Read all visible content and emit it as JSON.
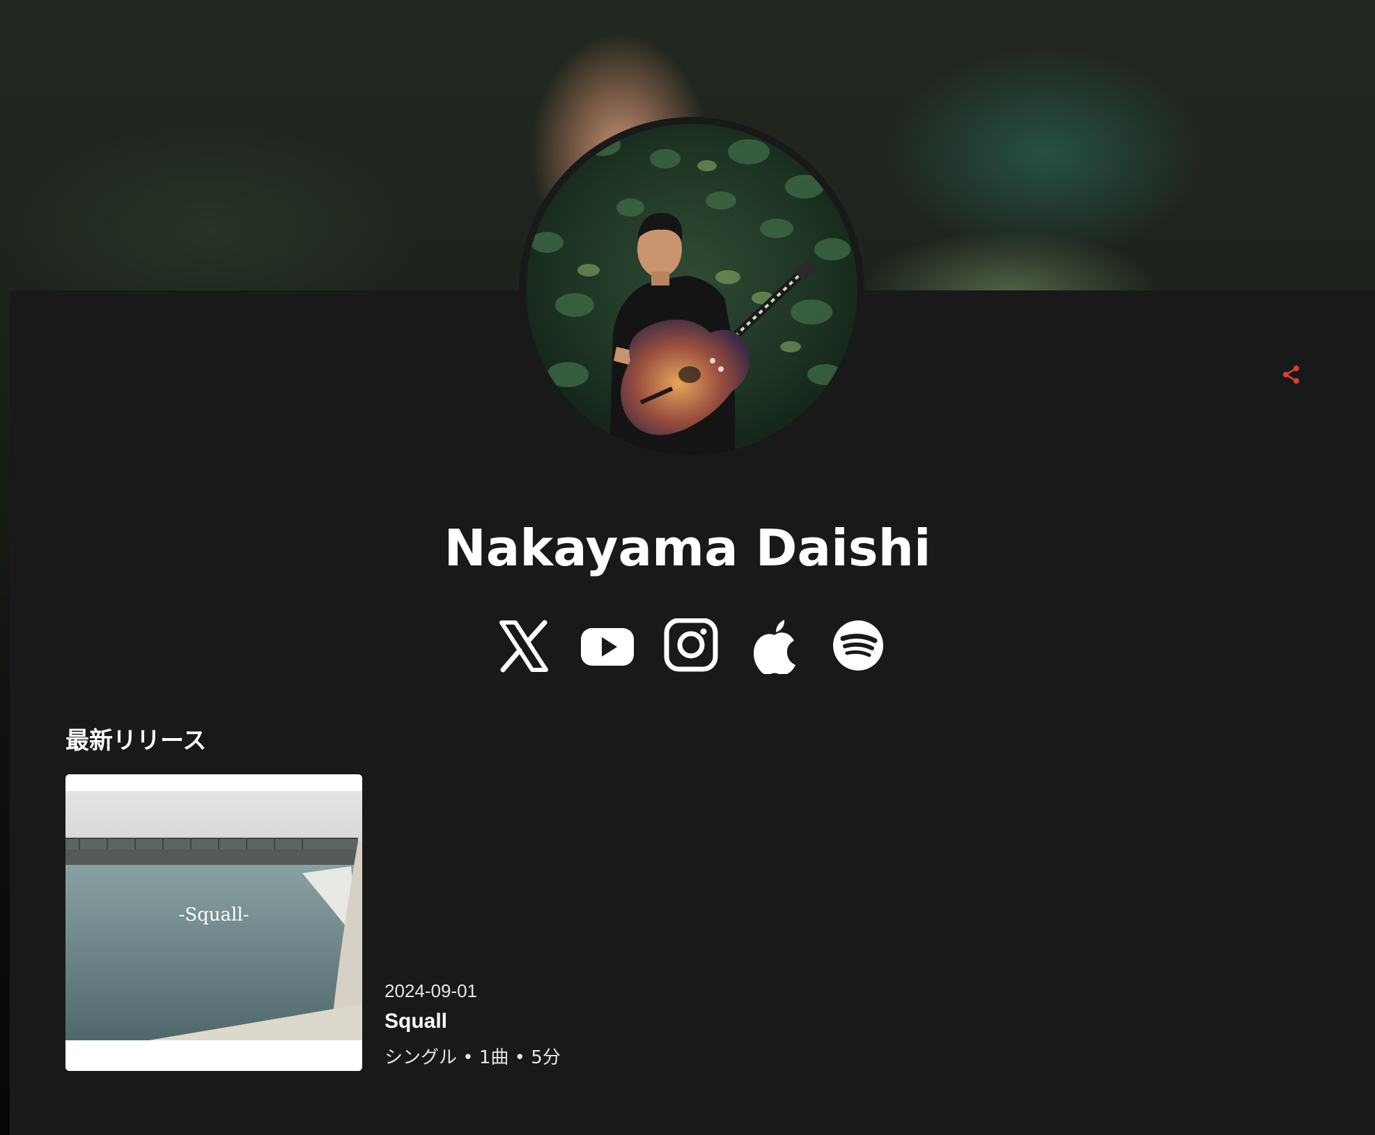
{
  "artist": {
    "name": "Nakayama Daishi"
  },
  "socials": [
    {
      "name": "x-icon",
      "label": "X"
    },
    {
      "name": "youtube-icon",
      "label": "YouTube"
    },
    {
      "name": "instagram-icon",
      "label": "Instagram"
    },
    {
      "name": "apple-music-icon",
      "label": "Apple Music"
    },
    {
      "name": "spotify-icon",
      "label": "Spotify"
    }
  ],
  "share": {
    "icon": "share-icon",
    "color": "#e0412f"
  },
  "latest_releases": {
    "title": "最新リリース",
    "items": [
      {
        "date": "2024-09-01",
        "title": "Squall",
        "meta": "シングル • 1曲 • 5分",
        "cover_text": "-Squall-"
      }
    ]
  },
  "colors": {
    "panel": "#191919",
    "text": "#ffffff",
    "accent": "#e0412f"
  }
}
